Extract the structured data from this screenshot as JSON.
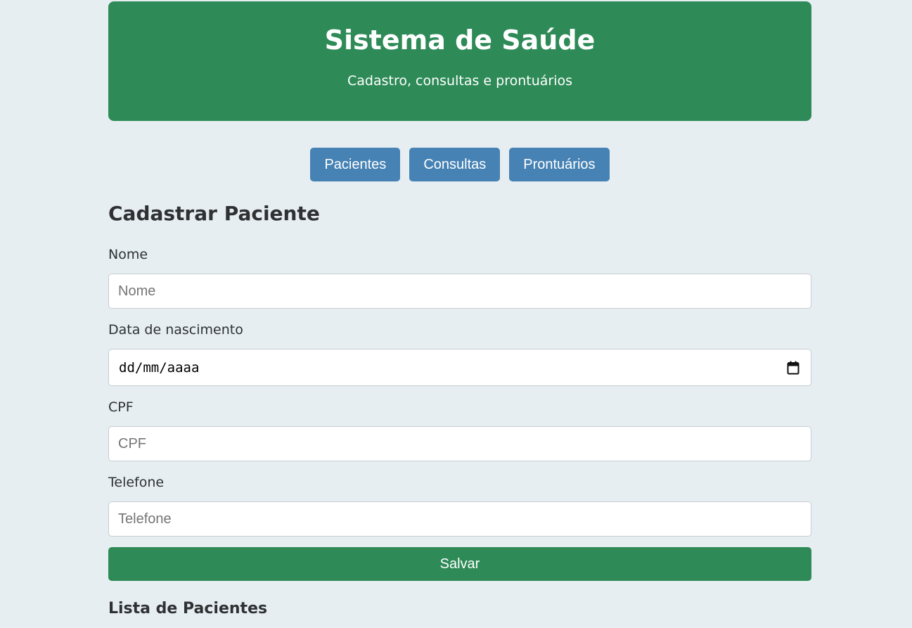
{
  "header": {
    "title": "Sistema de Saúde",
    "subtitle": "Cadastro, consultas e prontuários"
  },
  "nav": {
    "items": [
      {
        "label": "Pacientes"
      },
      {
        "label": "Consultas"
      },
      {
        "label": "Prontuários"
      }
    ]
  },
  "form": {
    "title": "Cadastrar Paciente",
    "nome": {
      "label": "Nome",
      "placeholder": "Nome",
      "value": ""
    },
    "nascimento": {
      "label": "Data de nascimento",
      "placeholder": "dd/mm/aaaa",
      "icon": "calendar-icon"
    },
    "cpf": {
      "label": "CPF",
      "placeholder": "CPF",
      "value": ""
    },
    "telefone": {
      "label": "Telefone",
      "placeholder": "Telefone",
      "value": ""
    },
    "save_label": "Salvar"
  },
  "list": {
    "title": "Lista de Pacientes"
  },
  "colors": {
    "background": "#e6eef2",
    "primary_green": "#2e8b57",
    "nav_blue": "#4682b4"
  }
}
